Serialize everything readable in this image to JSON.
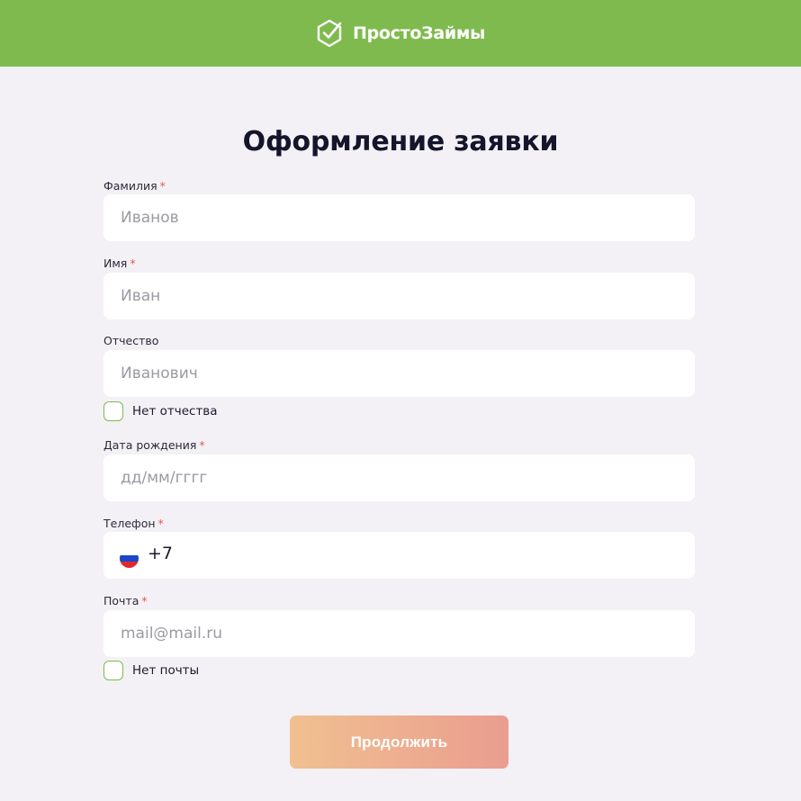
{
  "header": {
    "brand_name": "ПростоЗаймы",
    "logo_icon": "shield-check-icon",
    "background_color": "#7fba4e"
  },
  "form": {
    "title": "Оформление заявки",
    "required_mark": "*",
    "fields": {
      "last_name": {
        "label": "Фамилия",
        "placeholder": "Иванов",
        "required": true
      },
      "first_name": {
        "label": "Имя",
        "placeholder": "Иван",
        "required": true
      },
      "patronymic": {
        "label": "Отчество",
        "placeholder": "Иванович",
        "required": false
      },
      "birth_date": {
        "label": "Дата рождения",
        "placeholder": "дд/мм/гггг",
        "required": true
      },
      "phone": {
        "label": "Телефон",
        "value": "+7",
        "country_flag": "russia-flag-icon",
        "required": true
      },
      "email": {
        "label": "Почта",
        "placeholder": "mail@mail.ru",
        "required": true
      }
    },
    "checkboxes": {
      "no_patronymic": {
        "label": "Нет отчества",
        "checked": false
      },
      "no_email": {
        "label": "Нет почты",
        "checked": false
      }
    },
    "submit_label": "Продолжить",
    "accent_color": "#7fba4e"
  }
}
